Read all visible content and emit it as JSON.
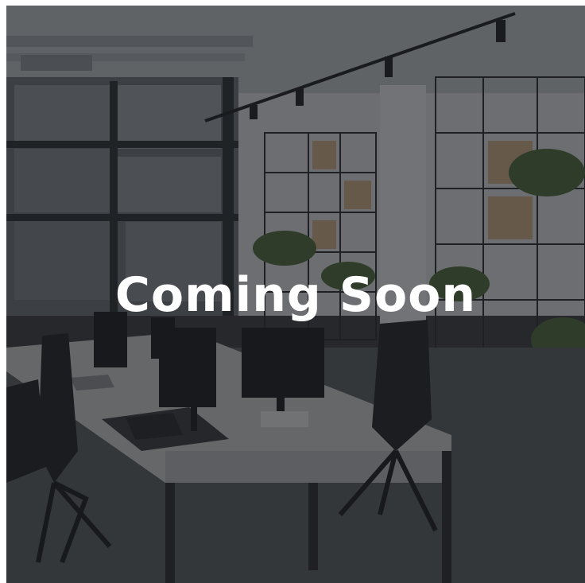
{
  "hero": {
    "title": "Coming Soon",
    "title_color": "#ffffff",
    "overlay_color": "#14161a",
    "background_image": "office-interior-photo"
  }
}
